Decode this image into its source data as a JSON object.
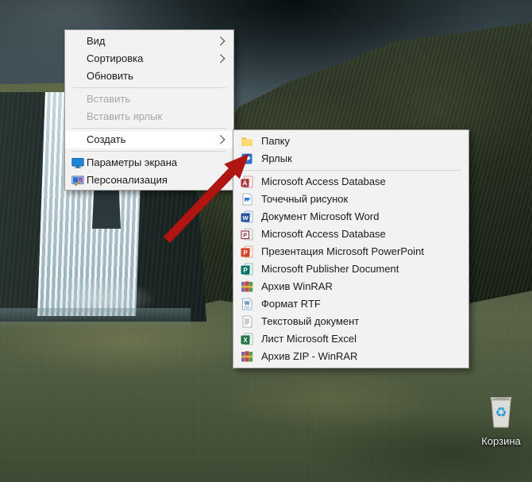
{
  "desktop": {
    "recycle_bin_label": "Корзина"
  },
  "context_menu": {
    "items": [
      {
        "label": "Вид",
        "has_submenu": true,
        "enabled": true
      },
      {
        "label": "Сортировка",
        "has_submenu": true,
        "enabled": true
      },
      {
        "label": "Обновить",
        "enabled": true
      },
      {
        "label": "Вставить",
        "enabled": false
      },
      {
        "label": "Вставить ярлык",
        "enabled": false
      },
      {
        "label": "Создать",
        "has_submenu": true,
        "enabled": true,
        "highlighted": true
      },
      {
        "label": "Параметры экрана",
        "icon": "display-icon",
        "enabled": true
      },
      {
        "label": "Персонализация",
        "icon": "personalization-icon",
        "enabled": true
      }
    ]
  },
  "submenu": {
    "items": [
      {
        "label": "Папку",
        "icon": "folder-icon"
      },
      {
        "label": "Ярлык",
        "icon": "shortcut-icon"
      },
      {
        "label": "Microsoft Access Database",
        "icon": "access-icon"
      },
      {
        "label": "Точечный рисунок",
        "icon": "bitmap-icon"
      },
      {
        "label": "Документ Microsoft Word",
        "icon": "word-icon"
      },
      {
        "label": "Microsoft Access Database",
        "icon": "access-legacy-icon"
      },
      {
        "label": "Презентация Microsoft PowerPoint",
        "icon": "powerpoint-icon"
      },
      {
        "label": "Microsoft Publisher Document",
        "icon": "publisher-icon"
      },
      {
        "label": "Архив WinRAR",
        "icon": "winrar-icon"
      },
      {
        "label": "Формат RTF",
        "icon": "rtf-icon"
      },
      {
        "label": "Текстовый документ",
        "icon": "text-icon"
      },
      {
        "label": "Лист Microsoft Excel",
        "icon": "excel-icon"
      },
      {
        "label": "Архив ZIP - WinRAR",
        "icon": "winrar-icon"
      }
    ]
  },
  "colors": {
    "menu_bg": "#f2f2f2",
    "menu_highlight": "#ffffff",
    "menu_border": "#9b9b9b",
    "menu_text": "#1a1a1a",
    "disabled_text": "#a6a6a6",
    "annotation_arrow_red": "#b11512",
    "folder_yellow": "#f9d978",
    "shortcut_blue": "#2e6fce",
    "word_blue": "#2b579a",
    "excel_green": "#217346",
    "powerpoint_orange": "#d24726",
    "access_red": "#a4373a",
    "publisher_teal": "#077568",
    "winrar_purple": "#7b68ae",
    "winrar_red": "#cf4537",
    "winrar_green": "#4d9e4d",
    "recycle_blue": "#2e9bd6"
  }
}
